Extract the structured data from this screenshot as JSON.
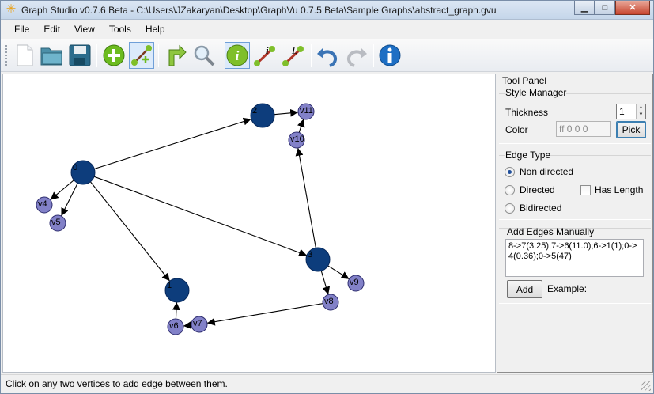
{
  "window": {
    "title": "Graph Studio v0.7.6 Beta - C:\\Users\\JZakaryan\\Desktop\\GraphVu 0.7.5 Beta\\Sample Graphs\\abstract_graph.gvu",
    "min_glyph": "▁",
    "max_glyph": "□",
    "close_glyph": "✕"
  },
  "menu": {
    "items": [
      "File",
      "Edit",
      "View",
      "Tools",
      "Help"
    ]
  },
  "toolbar": {
    "icons": [
      "new-file-icon",
      "open-folder-icon",
      "save-disk-icon",
      "add-vertex-icon",
      "add-edge-icon",
      "layout-arrow-icon",
      "zoom-magnifier-icon",
      "info-vertex-icon",
      "info-edge-icon",
      "length-edge-icon",
      "undo-icon",
      "redo-icon",
      "about-info-icon"
    ],
    "pressed": [
      "add-edge-icon",
      "info-vertex-icon"
    ]
  },
  "colors": {
    "vertex_large": "#0d3d7c",
    "vertex_small": "#8281c8",
    "edge": "#000000",
    "accent_green": "#6cbb1f"
  },
  "graph": {
    "vertices": [
      {
        "id": "v1",
        "label": "1",
        "size": "large"
      },
      {
        "id": "v2",
        "label": "2",
        "size": "large"
      },
      {
        "id": "v3",
        "label": "3",
        "size": "large"
      },
      {
        "id": "v4",
        "label": "v4",
        "size": "small"
      },
      {
        "id": "v5",
        "label": "v5",
        "size": "small"
      },
      {
        "id": "v6",
        "label": "v6",
        "size": "small"
      },
      {
        "id": "v7",
        "label": "v7",
        "size": "small"
      },
      {
        "id": "v8",
        "label": "v8",
        "size": "small"
      },
      {
        "id": "v9",
        "label": "v9",
        "size": "small"
      },
      {
        "id": "v10",
        "label": "v10",
        "size": "small"
      },
      {
        "id": "v11",
        "label": "v11",
        "size": "small"
      },
      {
        "id": "v0",
        "label": "0",
        "size": "large"
      }
    ],
    "edges": [
      [
        "v0",
        "v2"
      ],
      [
        "v0",
        "v3"
      ],
      [
        "v0",
        "v1"
      ],
      [
        "v0",
        "v4"
      ],
      [
        "v0",
        "v5"
      ],
      [
        "v2",
        "v11"
      ],
      [
        "v10",
        "v11"
      ],
      [
        "v3",
        "v10"
      ],
      [
        "v3",
        "v8"
      ],
      [
        "v3",
        "v9"
      ],
      [
        "v8",
        "v7"
      ],
      [
        "v7",
        "v6"
      ],
      [
        "v6",
        "v1"
      ]
    ]
  },
  "tool_panel": {
    "title": "Tool Panel",
    "style_manager": {
      "title": "Style Manager",
      "thickness_label": "Thickness",
      "thickness_value": "1",
      "color_label": "Color",
      "color_value": "ff 0 0 0",
      "pick_label": "Pick"
    },
    "edge_type": {
      "title": "Edge Type",
      "options": [
        "Non directed",
        "Directed",
        "Bidirected"
      ],
      "selected": "Non directed",
      "has_length_label": "Has Length",
      "has_length_checked": false
    },
    "add_edges": {
      "title": "Add Edges Manually",
      "text": "8->7(3.25);7->6(11.0);6->1(1);0->4(0.36);0->5(47)",
      "add_label": "Add",
      "example_label": "Example:"
    }
  },
  "status": {
    "text": "Click on any two vertices to add edge between them."
  }
}
